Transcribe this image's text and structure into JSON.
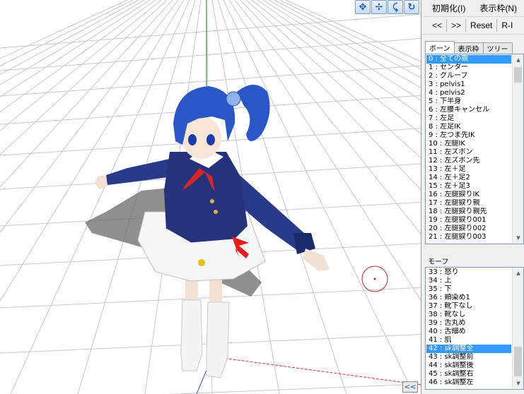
{
  "menu": {
    "init_label": "初期化(I)",
    "view_label": "表示枠(N)"
  },
  "nav": {
    "prev_label": "<<",
    "next_label": ">>",
    "reset_label": "Reset",
    "r_label": "R-I"
  },
  "tabs": [
    {
      "label": "ボーン"
    },
    {
      "label": "表示枠"
    },
    {
      "label": "ツリー"
    }
  ],
  "bone_list": {
    "selected_index": 0,
    "items": [
      "0 : 全ての親",
      "1 : センター",
      "2 : グルーブ",
      "3 : pelvis1",
      "4 : pelvis2",
      "5 : 下半身",
      "6 : 左腰キャンセル",
      "7 : 左足",
      "8 : 左足IK",
      "9 : 左つま先IK",
      "10 : 左腿IK",
      "11 : 左ズボン",
      "12 : 左ズボン先",
      "13 : 左＋足",
      "14 : 左＋足2",
      "15 : 左＋足3",
      "16 : 左腿捩りIK",
      "17 : 左腿捩り親",
      "18 : 左腿捩り親先",
      "19 : 左腿捩り001",
      "20 : 左腿捩り002",
      "21 : 左腿捩り003"
    ]
  },
  "morph": {
    "label": "モーフ",
    "selected_index": 9,
    "items": [
      "33 : 怒り",
      "34 : 上",
      "35 : 下",
      "36 : 頬染め1",
      "37 : 靴下なし",
      "38 : 靴なし",
      "39 : 舌丸め",
      "40 : 舌細め",
      "41 : 肌",
      "42 : sk調整全",
      "43 : sk調整前",
      "44 : sk調整後",
      "45 : sk調整右",
      "46 : sk調整左"
    ]
  },
  "viewport": {
    "collapse_label": "<<",
    "tool_icons": [
      "move-xyz-icon",
      "move-xy-icon",
      "rotate-local-icon",
      "rotate-view-icon"
    ]
  },
  "colors": {
    "selection": "#3399ff",
    "y_axis": "#1a8a1a",
    "x_axis": "#e03030",
    "hair": "#2a56c8",
    "coat": "#26327a"
  }
}
